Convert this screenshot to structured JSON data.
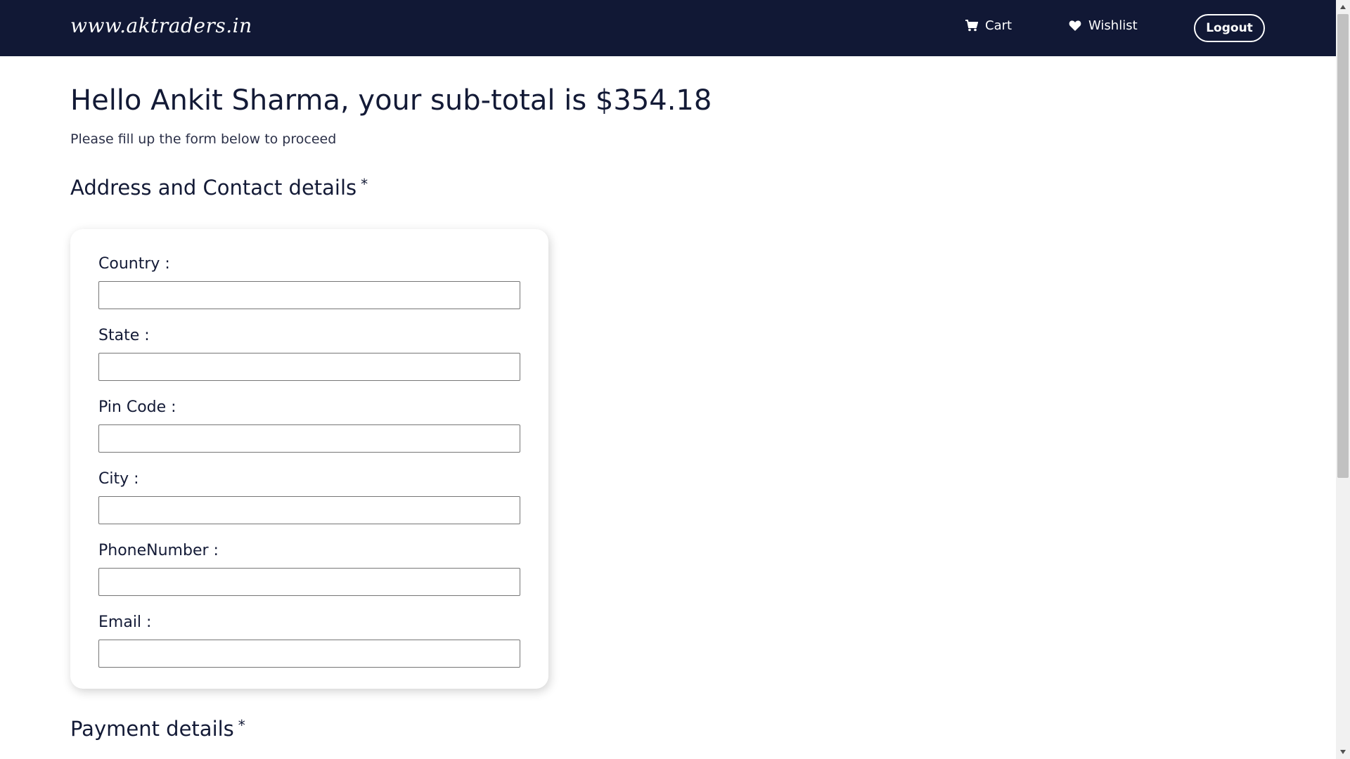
{
  "header": {
    "brand": "www.aktraders.in",
    "nav": {
      "cart_label": "Cart",
      "cart_icon": "cart-icon",
      "wishlist_label": "Wishlist",
      "wishlist_icon": "heart-icon",
      "logout_label": "Logout"
    }
  },
  "main": {
    "greeting": "Hello Ankit Sharma, your sub-total is $354.18",
    "instruction": "Please fill up the form below to proceed",
    "address_section": {
      "title": "Address and Contact details",
      "required_mark": "*",
      "fields": [
        {
          "label": "Country :",
          "value": ""
        },
        {
          "label": "State :",
          "value": ""
        },
        {
          "label": "Pin Code :",
          "value": ""
        },
        {
          "label": "City :",
          "value": ""
        },
        {
          "label": "PhoneNumber :",
          "value": ""
        },
        {
          "label": "Email :",
          "value": ""
        }
      ]
    },
    "payment_section": {
      "title": "Payment details",
      "required_mark": "*"
    }
  },
  "colors": {
    "navbar_bg": "#111835",
    "text_primary": "#131a36",
    "card_bg": "#ffffff"
  }
}
